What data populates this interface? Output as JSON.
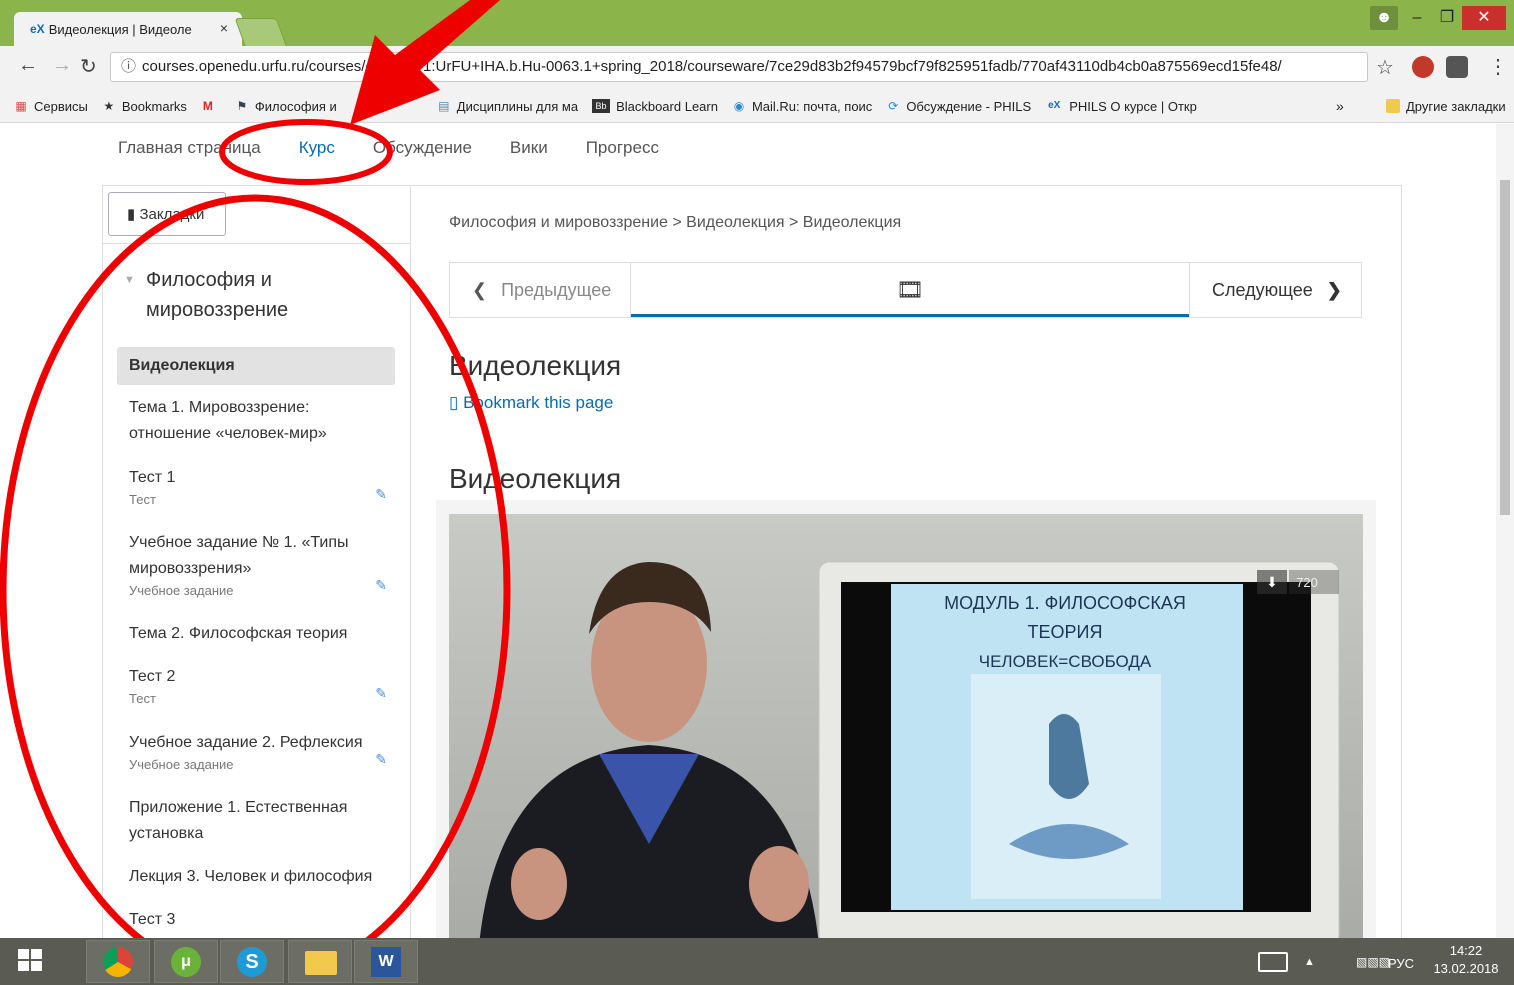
{
  "browser": {
    "tab_title": "Видеолекция | Видеоле",
    "tab_favicon": "eX",
    "tab_close": "×",
    "url": "courses.openedu.urfu.ru/courses/course-v1:UrFU+IHA.b.Hu-0063.1+spring_2018/courseware/7ce29d83b2f94579bcf79f825951fadb/770af43110db4cb0a875569ecd15fe48/"
  },
  "bookmarks_bar": {
    "items": [
      {
        "label": "Сервисы",
        "icon": "apps-grid-icon"
      },
      {
        "label": "Bookmarks",
        "icon": "star-icon"
      },
      {
        "label": "",
        "icon": "m-logo-icon"
      },
      {
        "label": "Философия и",
        "icon": "flag-icon"
      },
      {
        "label": "Дисциплины для ма",
        "icon": "doc-icon"
      },
      {
        "label": "Blackboard Learn",
        "icon": "bb-icon"
      },
      {
        "label": "Mail.Ru: почта, поис",
        "icon": "mailru-icon"
      },
      {
        "label": "Обсуждение - PHILS",
        "icon": "spinner-icon"
      },
      {
        "label": "PHILS О курсе | Откр",
        "icon": "edx-icon"
      }
    ],
    "more": "»",
    "other": "Другие закладки"
  },
  "course_nav": {
    "items": [
      "Главная страница",
      "Курс",
      "Обсуждение",
      "Вики",
      "Прогресс"
    ]
  },
  "sidebar": {
    "bookmarks_button": "Закладки",
    "chapter": "Философия и мировоззрение",
    "items": [
      {
        "label": "Видеолекция",
        "sub": ""
      },
      {
        "label": "Тема 1. Мировоззрение: отношение «человек-мир»",
        "sub": ""
      },
      {
        "label": "Тест 1",
        "sub": "Тест"
      },
      {
        "label": "Учебное задание № 1. «Типы мировоззрения»",
        "sub": "Учебное задание"
      },
      {
        "label": "Тема 2. Философская теория",
        "sub": ""
      },
      {
        "label": "Тест 2",
        "sub": "Тест"
      },
      {
        "label": "Учебное задание 2. Рефлексия",
        "sub": "Учебное задание"
      },
      {
        "label": "Приложение 1. Естественная установка",
        "sub": ""
      },
      {
        "label": "Лекция 3. Человек и философия",
        "sub": ""
      },
      {
        "label": "Тест 3",
        "sub": ""
      }
    ]
  },
  "content": {
    "breadcrumb": "Философия и мировоззрение > Видеолекция > Видеолекция",
    "prev": "Предыдущее",
    "next": "Следующее",
    "unit_title": "Видеолекция",
    "bookmark_link": "Bookmark this page",
    "video_title": "Видеолекция",
    "video_quality": "720",
    "slide_line1": "МОДУЛЬ 1. ФИЛОСОФСКАЯ",
    "slide_line2": "ТЕОРИЯ",
    "slide_line3": "ЧЕЛОВЕК=СВОБОДА"
  },
  "taskbar": {
    "lang": "РУС",
    "time": "14:22",
    "date": "13.02.2018"
  },
  "colors": {
    "titlebar": "#8bb44a",
    "link": "#0a6ab0",
    "annotation": "#ee0000"
  }
}
